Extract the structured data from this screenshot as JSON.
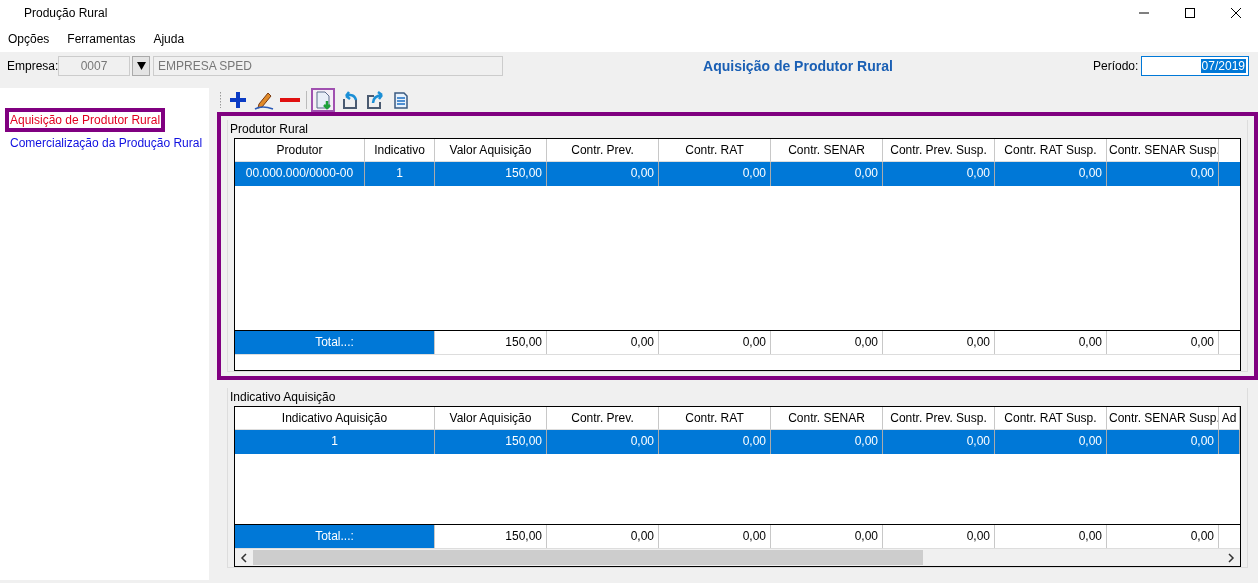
{
  "window": {
    "title": "Produção Rural"
  },
  "menu": [
    "Opções",
    "Ferramentas",
    "Ajuda"
  ],
  "empresa": {
    "label": "Empresa:",
    "code": "0007",
    "name": "EMPRESA SPED",
    "disabled": true
  },
  "page_title": "Aquisição de Produtor Rural",
  "periodo": {
    "label": "Período:",
    "value": "07/2019",
    "text_selected": true
  },
  "sidebar": {
    "items": [
      {
        "label": "Aquisição de Produtor Rural",
        "selected": true
      },
      {
        "label": "Comercialização da Produção Rural",
        "selected": false
      }
    ]
  },
  "toolbar": [
    {
      "kind": "add",
      "highlighted": false
    },
    {
      "kind": "edit",
      "highlighted": false
    },
    {
      "kind": "remove",
      "highlighted": false
    },
    {
      "kind": "separator"
    },
    {
      "kind": "import",
      "highlighted": true
    },
    {
      "kind": "undo",
      "highlighted": false
    },
    {
      "kind": "export",
      "highlighted": false
    },
    {
      "kind": "report",
      "highlighted": false
    }
  ],
  "groups": [
    {
      "title": "Produtor Rural",
      "highlighted": true,
      "scrollbar": false,
      "columns": [
        "Produtor",
        "Indicativo",
        "Valor Aquisição",
        "Contr. Prev.",
        "Contr. RAT",
        "Contr. SENAR",
        "Contr. Prev. Susp.",
        "Contr. RAT Susp.",
        "Contr. SENAR Susp."
      ],
      "rows": [
        {
          "selected": true,
          "cells": [
            "00.000.000/0000-00",
            "1",
            "150,00",
            "0,00",
            "0,00",
            "0,00",
            "0,00",
            "0,00",
            "0,00"
          ]
        }
      ],
      "total": {
        "label": "Total...:",
        "values": [
          "150,00",
          "0,00",
          "0,00",
          "0,00",
          "0,00",
          "0,00",
          "0,00"
        ]
      }
    },
    {
      "title": "Indicativo Aquisição",
      "highlighted": false,
      "scrollbar": true,
      "columns": [
        "Indicativo Aquisição",
        "Valor Aquisição",
        "Contr. Prev.",
        "Contr. RAT",
        "Contr. SENAR",
        "Contr. Prev. Susp.",
        "Contr. RAT Susp.",
        "Contr. SENAR Susp.",
        "Ad"
      ],
      "rows": [
        {
          "selected": true,
          "cells": [
            "1",
            "150,00",
            "0,00",
            "0,00",
            "0,00",
            "0,00",
            "0,00",
            "0,00",
            ""
          ]
        }
      ],
      "total": {
        "label": "Total...:",
        "values": [
          "150,00",
          "0,00",
          "0,00",
          "0,00",
          "0,00",
          "0,00",
          "0,00"
        ]
      }
    }
  ]
}
